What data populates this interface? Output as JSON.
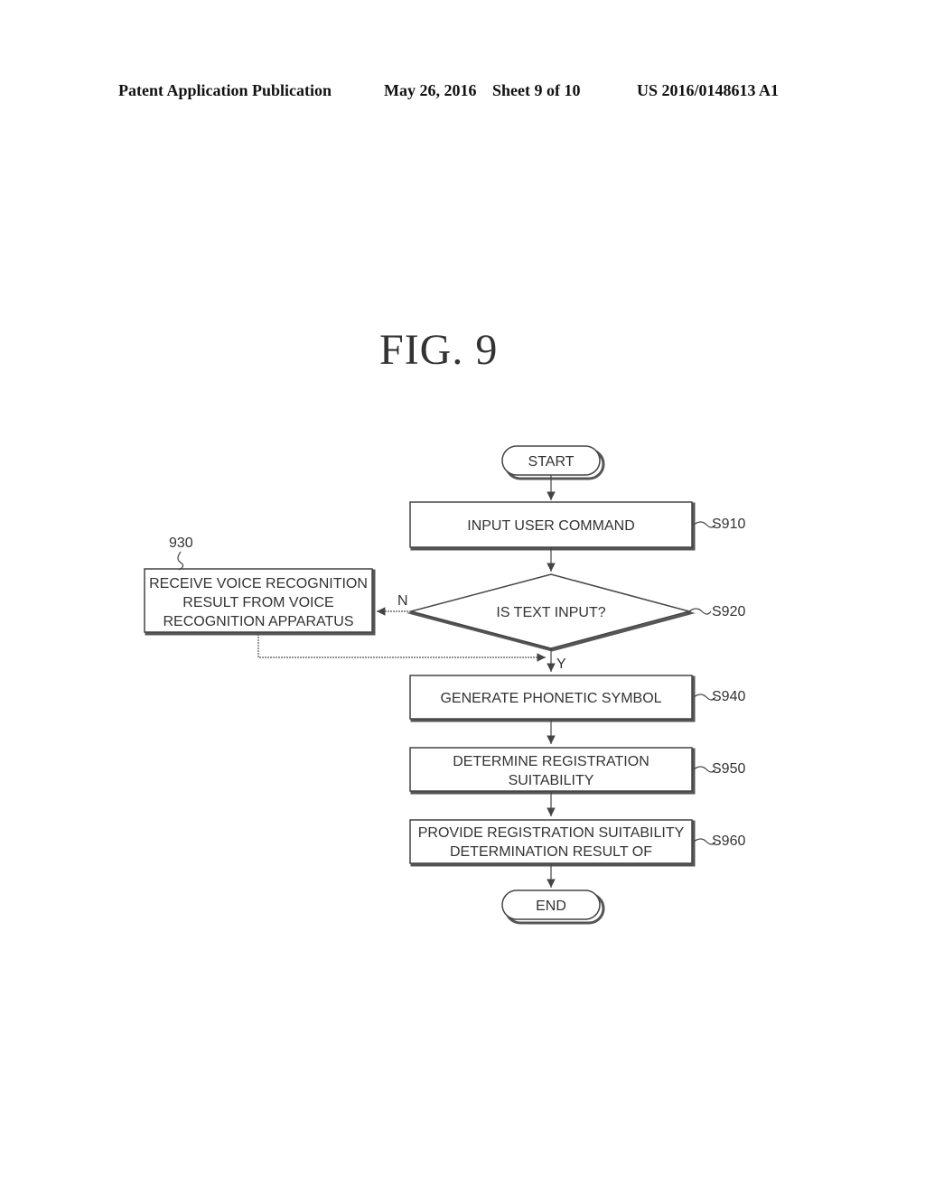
{
  "header": {
    "publication": "Patent Application Publication",
    "date": "May 26, 2016",
    "sheet": "Sheet 9 of 10",
    "number": "US 2016/0148613 A1"
  },
  "figure": {
    "title": "FIG.  9"
  },
  "flowchart": {
    "start": "START",
    "end": "END",
    "steps": {
      "s910": {
        "ref": "S910",
        "lines": [
          "INPUT USER COMMAND"
        ]
      },
      "s920": {
        "ref": "S920",
        "lines": [
          "IS TEXT INPUT?"
        ]
      },
      "s930": {
        "ref": "930",
        "lines": [
          "RECEIVE VOICE RECOGNITION",
          "RESULT FROM VOICE",
          "RECOGNITION APPARATUS"
        ]
      },
      "s940": {
        "ref": "S940",
        "lines": [
          "GENERATE PHONETIC SYMBOL"
        ]
      },
      "s950": {
        "ref": "S950",
        "lines": [
          "DETERMINE REGISTRATION",
          "SUITABILITY"
        ]
      },
      "s960": {
        "ref": "S960",
        "lines": [
          "PROVIDE REGISTRATION SUITABILITY",
          "DETERMINATION RESULT OF"
        ]
      }
    },
    "branches": {
      "no": "N",
      "yes": "Y"
    }
  }
}
